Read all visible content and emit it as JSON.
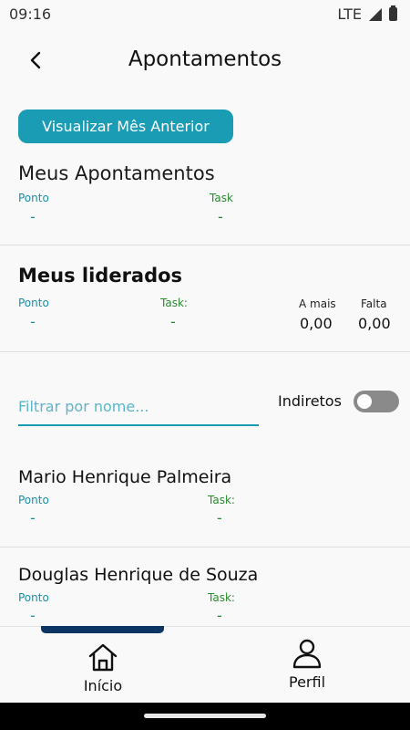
{
  "status_bar": {
    "time": "09:16",
    "network": "LTE"
  },
  "header": {
    "title": "Apontamentos"
  },
  "prev_month_button": "Visualizar Mês Anterior",
  "my_records": {
    "title": "Meus Apontamentos",
    "ponto_label": "Ponto",
    "task_label": "Task",
    "ponto_value": "-",
    "task_value": "-"
  },
  "led": {
    "title": "Meus liderados",
    "ponto_label": "Ponto",
    "task_label": "Task:",
    "ponto_value": "-",
    "task_value": "-",
    "extra_label": "A mais",
    "extra_value": "0,00",
    "missing_label": "Falta",
    "missing_value": "0,00"
  },
  "filter": {
    "placeholder": "Filtrar por nome...",
    "value": "",
    "indirect_label": "Indiretos",
    "indirect_on": false
  },
  "people": [
    {
      "name": "Mario Henrique Palmeira",
      "ponto_label": "Ponto",
      "task_label": "Task:",
      "ponto_value": "-",
      "task_value": "-"
    },
    {
      "name": "Douglas Henrique de Souza",
      "ponto_label": "Ponto",
      "task_label": "Task:",
      "ponto_value": "-",
      "task_value": "-"
    }
  ],
  "bottom_nav": {
    "items": [
      {
        "label": "Início",
        "icon": "home-icon",
        "active": true
      },
      {
        "label": "Perfil",
        "icon": "person-icon",
        "active": false
      }
    ]
  },
  "colors": {
    "accent": "#1a9cb4",
    "task_green": "#2a8a30",
    "nav_indicator": "#0d3563"
  }
}
